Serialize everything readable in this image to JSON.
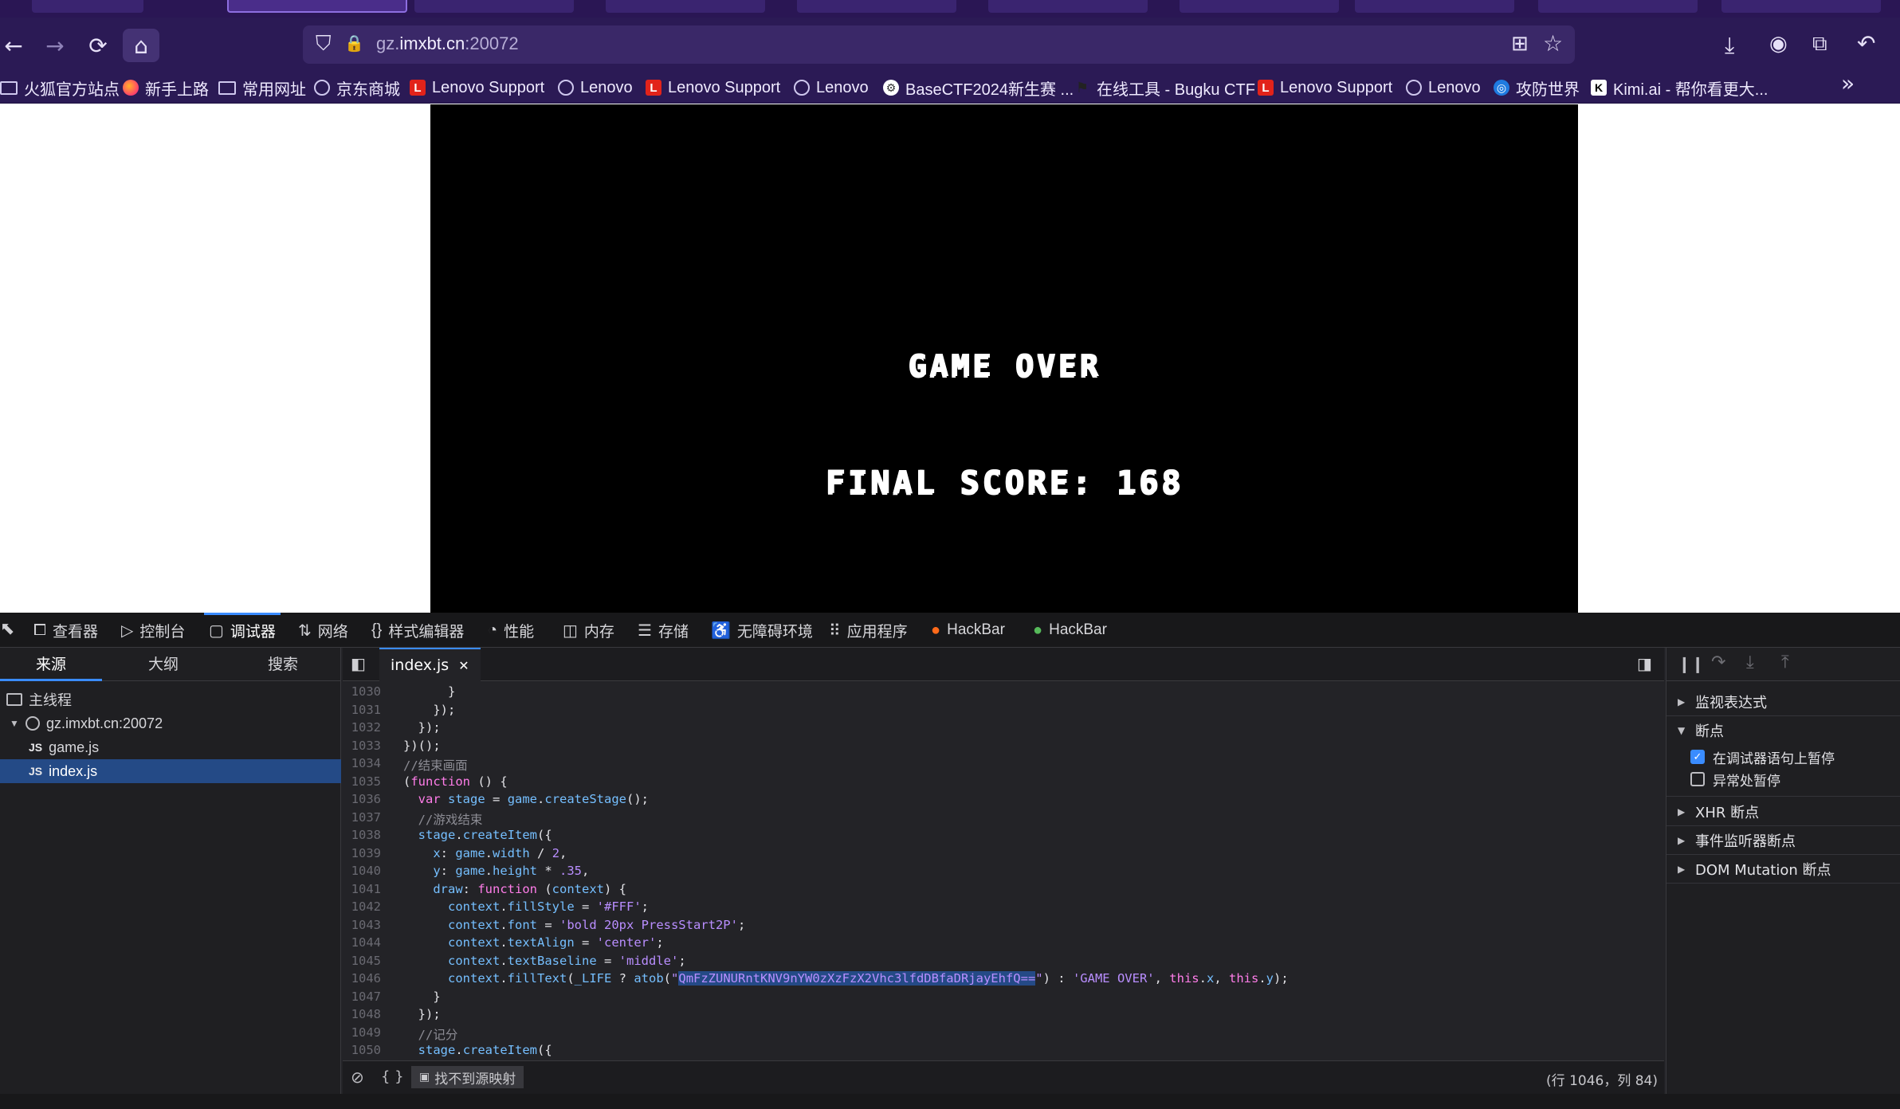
{
  "browser": {
    "url_prefix": "gz.",
    "url_host": "imxbt.cn",
    "url_port": ":20072",
    "icons": {
      "back": "←",
      "forward": "→",
      "reload": "⟳",
      "home": "⌂",
      "shield": "⛉",
      "lock": "🔒",
      "qr": "⊞",
      "star": "☆",
      "download": "⤓",
      "account": "◉",
      "crop": "⧉",
      "undo": "↶",
      "more": "»"
    }
  },
  "bookmarks": [
    {
      "label": "火狐官方站点",
      "icon": "folder"
    },
    {
      "label": "新手上路",
      "icon": "fox"
    },
    {
      "label": "常用网址",
      "icon": "folder"
    },
    {
      "label": "京东商城",
      "icon": "globe"
    },
    {
      "label": "Lenovo Support",
      "icon": "lenovo"
    },
    {
      "label": "Lenovo",
      "icon": "globe"
    },
    {
      "label": "Lenovo Support",
      "icon": "lenovo"
    },
    {
      "label": "Lenovo",
      "icon": "globe"
    },
    {
      "label": "BaseCTF2024新生赛 ...",
      "icon": "gear"
    },
    {
      "label": "在线工具 - Bugku CTF",
      "icon": "flag"
    },
    {
      "label": "Lenovo Support",
      "icon": "lenovo"
    },
    {
      "label": "Lenovo",
      "icon": "globe"
    },
    {
      "label": "攻防世界",
      "icon": "world"
    },
    {
      "label": "Kimi.ai - 帮你看更大...",
      "icon": "kimi"
    }
  ],
  "game": {
    "title": "GAME OVER",
    "score_text": "FINAL SCORE: 168"
  },
  "devtools": {
    "tabs": [
      {
        "label": "查看器",
        "icon": "⧠"
      },
      {
        "label": "控制台",
        "icon": "▷"
      },
      {
        "label": "调试器",
        "icon": "▢"
      },
      {
        "label": "网络",
        "icon": "⇅"
      },
      {
        "label": "样式编辑器",
        "icon": "{}"
      },
      {
        "label": "性能",
        "icon": "◔"
      },
      {
        "label": "内存",
        "icon": "◫"
      },
      {
        "label": "存储",
        "icon": "☰"
      },
      {
        "label": "无障碍环境",
        "icon": "♿"
      },
      {
        "label": "应用程序",
        "icon": "⠿"
      },
      {
        "label": "HackBar",
        "icon": "●"
      },
      {
        "label": "HackBar",
        "icon": "●"
      }
    ],
    "sources_tabs": [
      "来源",
      "大纲",
      "搜索"
    ],
    "tree": {
      "thread": "主线程",
      "host": "gz.imxbt.cn:20072",
      "files": [
        "game.js",
        "index.js"
      ],
      "js_badge": "JS"
    },
    "editor_tab": "index.js",
    "close_glyph": "✕",
    "status_left": "找不到源映射",
    "status_braces": "{ }",
    "cursor_pos": "(行 1046，列 84)",
    "code": {
      "line_numbers": [
        "1030",
        "1031",
        "1032",
        "1033",
        "1034",
        "1035",
        "1036",
        "1037",
        "1038",
        "1039",
        "1040",
        "1041",
        "1042",
        "1043",
        "1044",
        "1045",
        "1046",
        "1047",
        "1048",
        "1049",
        "1050"
      ],
      "encoded": "QmFzZUNURntKNV9nYW0zXzFzX2Vhc3lfdDBfaDRjayEhfQ=="
    },
    "watch": "监视表达式",
    "breakpoints": "断点",
    "pause_on_debugger": "在调试器语句上暂停",
    "pause_on_exception": "异常处暂停",
    "xhr_bp": "XHR 断点",
    "event_bp": "事件监听器断点",
    "dom_bp": "DOM Mutation 断点",
    "checkbox_checked": "✓"
  }
}
